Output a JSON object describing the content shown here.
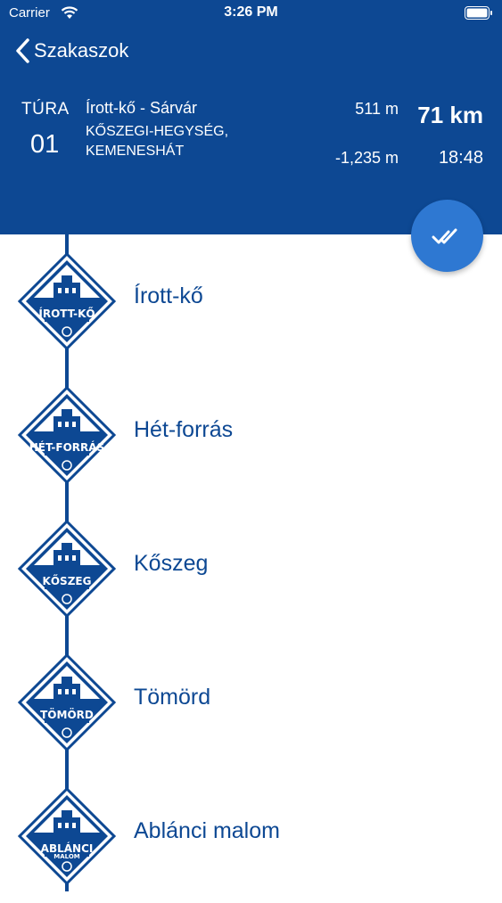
{
  "status_bar": {
    "carrier": "Carrier",
    "time": "3:26 PM"
  },
  "nav": {
    "back_label": "Szakaszok"
  },
  "header": {
    "tura_label": "TÚRA",
    "tura_number": "01",
    "route": "Írott-kő - Sárvár",
    "region": "KŐSZEGI-HEGYSÉG, KEMENESHÁT",
    "elevation_up": "511 m",
    "elevation_down": "-1,235 m",
    "distance": "71 km",
    "duration": "18:48"
  },
  "colors": {
    "primary": "#0d4893",
    "fab": "#2e78d2",
    "background": "#ffffff"
  },
  "stages": [
    {
      "name": "Írott-kő",
      "badge": "ÍROTT-KŐ",
      "badge_sub": ""
    },
    {
      "name": "Hét-forrás",
      "badge": "HÉT-FORRÁS",
      "badge_sub": ""
    },
    {
      "name": "Kőszeg",
      "badge": "KŐSZEG",
      "badge_sub": ""
    },
    {
      "name": "Tömörd",
      "badge": "TÖMÖRD",
      "badge_sub": ""
    },
    {
      "name": "Ablánci malom",
      "badge": "ABLÁNCI",
      "badge_sub": "MALOM"
    }
  ]
}
